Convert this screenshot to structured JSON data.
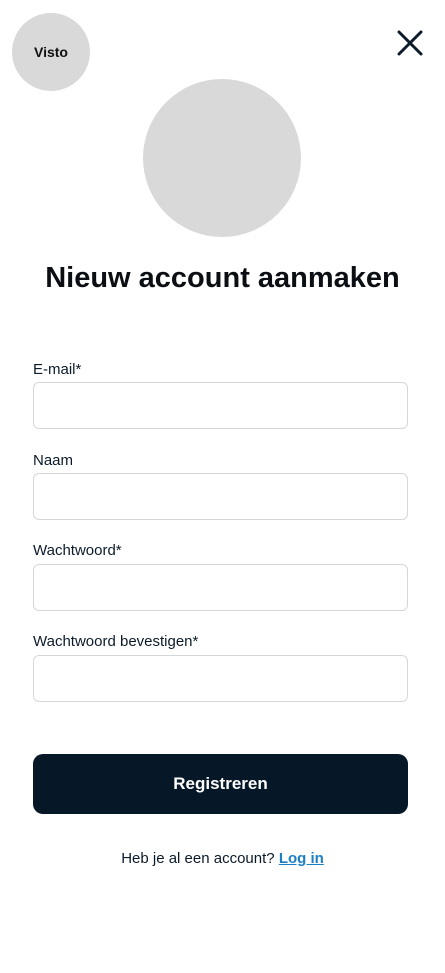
{
  "brand": {
    "logo_text": "Visto"
  },
  "header": {
    "close_icon": "close-icon"
  },
  "page": {
    "title": "Nieuw account aanmaken"
  },
  "form": {
    "fields": [
      {
        "label": "E-mail*",
        "value": "",
        "placeholder": ""
      },
      {
        "label": "Naam",
        "value": "",
        "placeholder": ""
      },
      {
        "label": "Wachtwoord*",
        "value": "",
        "placeholder": ""
      },
      {
        "label": "Wachtwoord bevestigen*",
        "value": "",
        "placeholder": ""
      }
    ],
    "submit_label": "Registreren"
  },
  "footer": {
    "prompt": "Heb je al een account?",
    "login_label": "Log in"
  },
  "colors": {
    "button_bg": "#061827",
    "link": "#1a7fc4",
    "placeholder_gray": "#d9d9d9"
  }
}
